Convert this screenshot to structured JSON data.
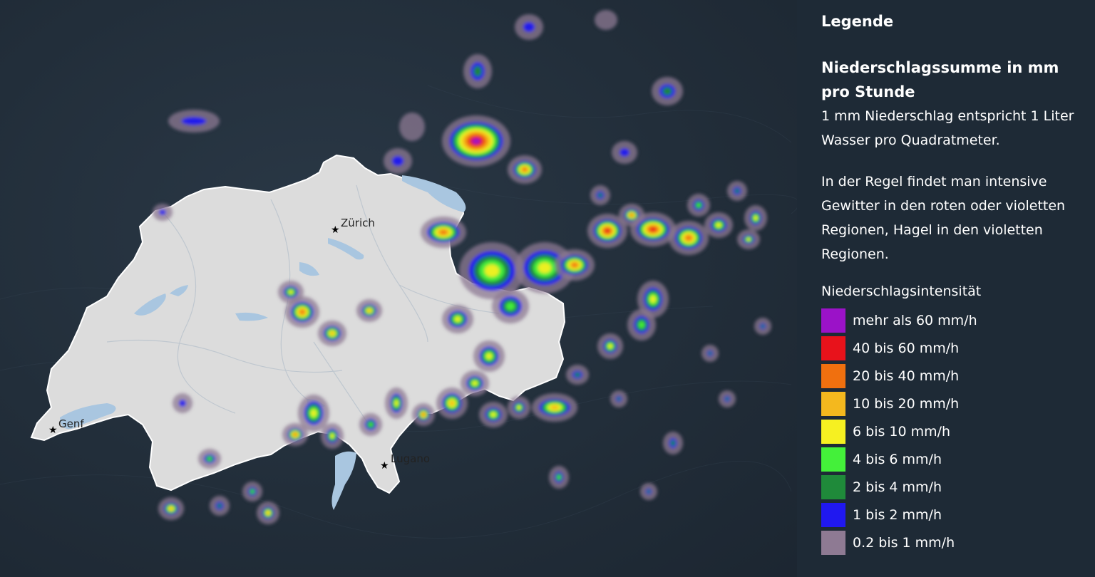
{
  "legend": {
    "title": "Legende",
    "subtitle": "Niederschlagssumme in mm pro Stunde",
    "description": "1 mm Niederschlag entspricht 1 Liter Wasser pro Quadratmeter.",
    "note": "In der Regel findet man intensive Gewitter in den roten oder violetten Regionen, Hagel in den violetten Regionen.",
    "scale_heading": "Niederschlagsintensität",
    "scale": [
      {
        "label": "mehr als 60 mm/h",
        "color": "#9b12c8"
      },
      {
        "label": "40 bis 60 mm/h",
        "color": "#e8121b"
      },
      {
        "label": "20 bis 40 mm/h",
        "color": "#f0700f"
      },
      {
        "label": "10 bis 20 mm/h",
        "color": "#f4b81e"
      },
      {
        "label": "6 bis 10 mm/h",
        "color": "#f6f021"
      },
      {
        "label": "4 bis 6 mm/h",
        "color": "#44f03a"
      },
      {
        "label": "2 bis 4 mm/h",
        "color": "#1f8a3a"
      },
      {
        "label": "1 bis 2 mm/h",
        "color": "#2018f0"
      },
      {
        "label": "0.2 bis 1 mm/h",
        "color": "#8e7a93"
      }
    ]
  },
  "map": {
    "country_color": "#dcdcdc",
    "lake_color": "#a9c6e0",
    "cities": [
      {
        "name": "Zürich",
        "icon": "star-icon"
      },
      {
        "name": "Genf",
        "icon": "star-icon"
      },
      {
        "name": "Lugano",
        "icon": "star-icon"
      }
    ]
  }
}
